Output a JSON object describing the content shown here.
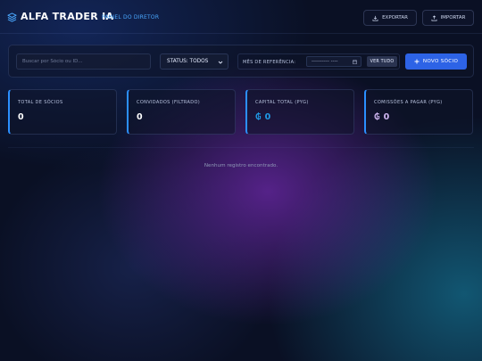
{
  "header": {
    "brand": "ALFA TRADER IA",
    "subtitle": "PAINEL DO DIRETOR",
    "export_label": "EXPORTAR",
    "import_label": "IMPORTAR"
  },
  "toolbar": {
    "search_placeholder": "Buscar por Sócio ou ID...",
    "status_value": "STATUS: TODOS",
    "month_label": "MÊS DE REFERÊNCIA:",
    "month_value": "---------- ----",
    "see_all_label": "VER TUDO",
    "new_partner_label": "NOVO SÓCIO"
  },
  "stats": [
    {
      "label": "TOTAL DE SÓCIOS",
      "value": "0"
    },
    {
      "label": "CONVIDADOS (FILTRADO)",
      "value": "0"
    },
    {
      "label": "CAPITAL TOTAL (PYG)",
      "currency": "₲",
      "value": "0",
      "accent": "#1f9be8"
    },
    {
      "label": "COMISSÕES A PAGAR (PYG)",
      "currency": "₲",
      "value": "0",
      "accent": "#d0b6f2"
    }
  ],
  "results": {
    "empty_message": "Nenhum registro encontrado."
  },
  "colors": {
    "primary": "#2d63e6",
    "card_accent": "#2b8fff",
    "subtitle": "#4aa8ff"
  }
}
